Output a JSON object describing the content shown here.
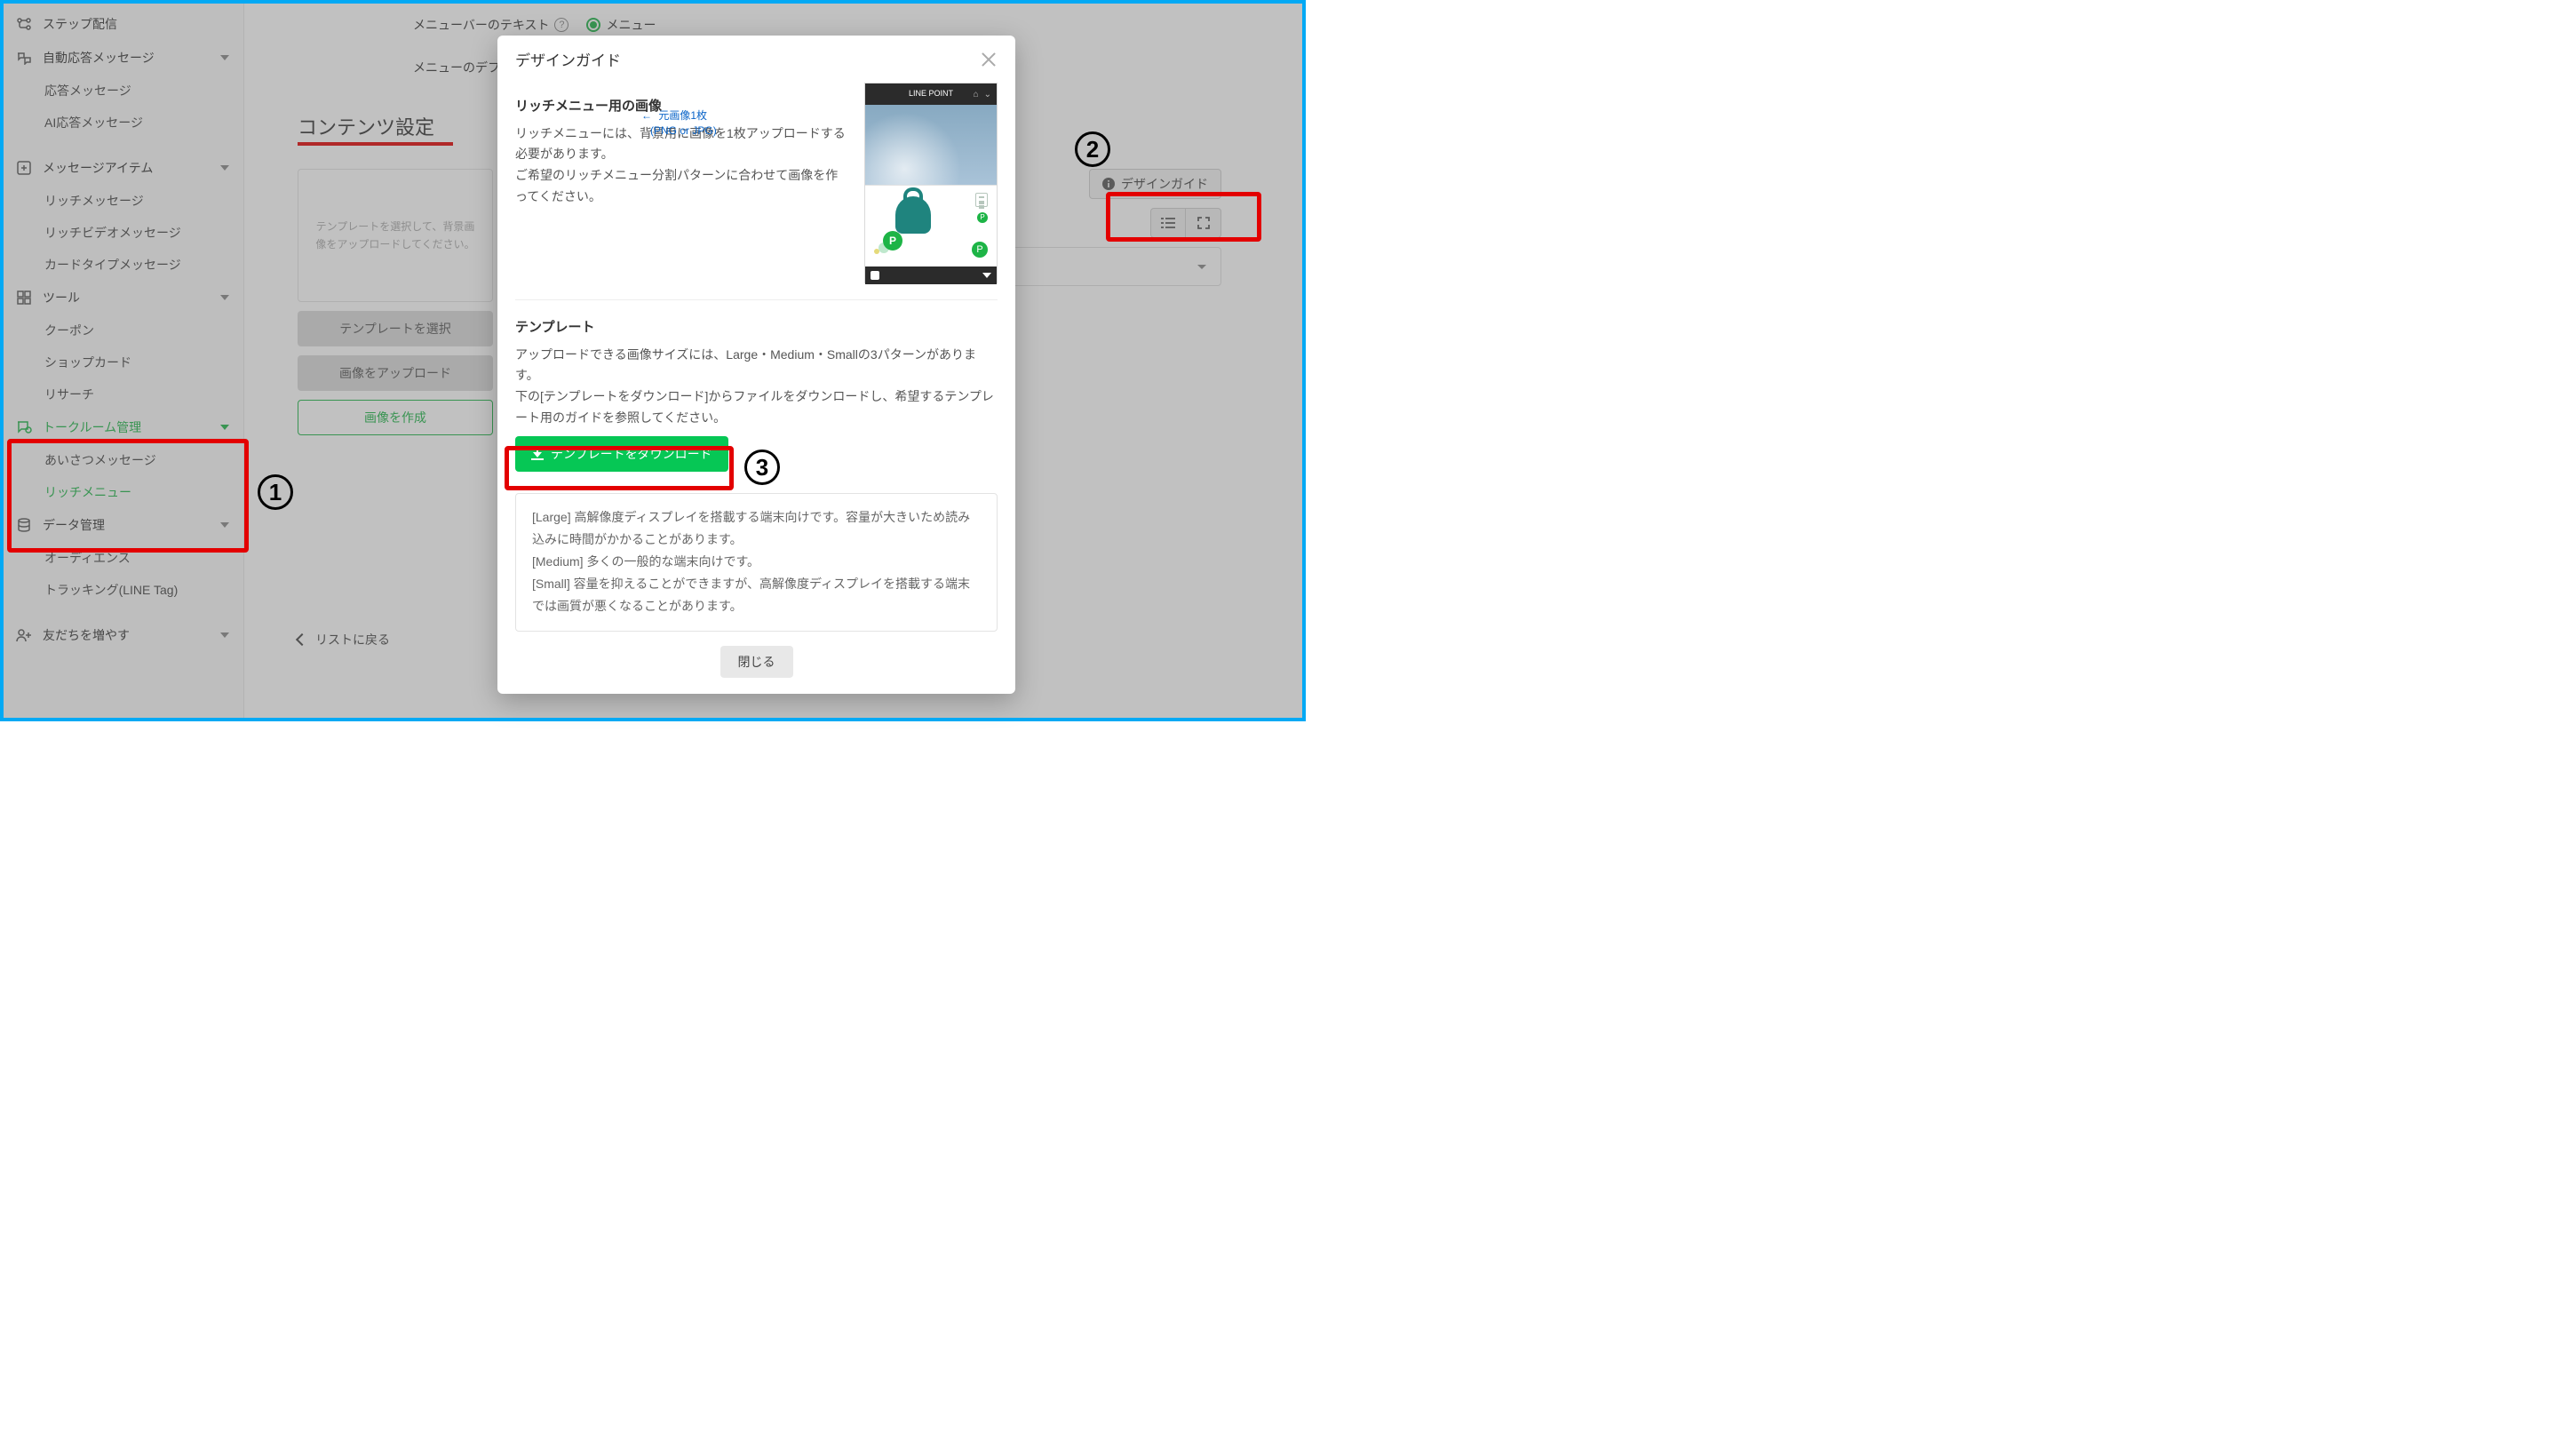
{
  "sidebar": {
    "step_delivery": "ステップ配信",
    "auto_reply": "自動応答メッセージ",
    "auto_reply_sub": {
      "reply_msg": "応答メッセージ",
      "ai_reply_msg": "AI応答メッセージ"
    },
    "msg_items": "メッセージアイテム",
    "msg_items_sub": {
      "rich_msg": "リッチメッセージ",
      "rich_video_msg": "リッチビデオメッセージ",
      "card_type_msg": "カードタイプメッセージ"
    },
    "tools": "ツール",
    "tools_sub": {
      "coupon": "クーポン",
      "shop_card": "ショップカード",
      "research": "リサーチ"
    },
    "talkroom": "トークルーム管理",
    "talkroom_sub": {
      "greeting": "あいさつメッセージ",
      "rich_menu": "リッチメニュー"
    },
    "data_mgmt": "データ管理",
    "data_mgmt_sub": {
      "audience": "オーディエンス",
      "tracking": "トラッキング(LINE Tag)"
    },
    "friends": "友だちを増やす"
  },
  "main": {
    "menubar_text": "メニューバーのテキスト",
    "menu": "メニュー",
    "menu_default": "メニューのデフ",
    "content_settings": "コンテンツ設定",
    "placeholder": "テンプレートを選択して、背景画像をアップロードしてください。",
    "btn_select_template": "テンプレートを選択",
    "btn_upload_image": "画像をアップロード",
    "btn_create_image": "画像を作成",
    "design_guide_btn": "デザインガイド",
    "back_to_list": "リストに戻る"
  },
  "modal": {
    "title": "デザインガイド",
    "sec1_title": "リッチメニュー用の画像",
    "sec1_p1": "リッチメニューには、背景用に画像を1枚アップロードする必要があります。",
    "sec1_p2": "ご希望のリッチメニュー分割パターンに合わせて画像を作ってください。",
    "phone_title": "LINE POINT",
    "note_l1": "元画像1枚",
    "note_l2": "(PNG or JPG)",
    "sec2_title": "テンプレート",
    "sec2_p1": "アップロードできる画像サイズには、Large・Medium・Smallの3パターンがあります。",
    "sec2_p2": "下の[テンプレートをダウンロード]からファイルをダウンロードし、希望するテンプレート用のガイドを参照してください。",
    "download_btn": "テンプレートをダウンロード",
    "info_large": "[Large] 高解像度ディスプレイを搭載する端末向けです。容量が大きいため読み込みに時間がかかることがあります。",
    "info_medium": "[Medium] 多くの一般的な端末向けです。",
    "info_small": "[Small] 容量を抑えることができますが、高解像度ディスプレイを搭載する端末では画質が悪くなることがあります。",
    "close_btn": "閉じる"
  },
  "annotations": {
    "n1": "1",
    "n2": "2",
    "n3": "3"
  }
}
